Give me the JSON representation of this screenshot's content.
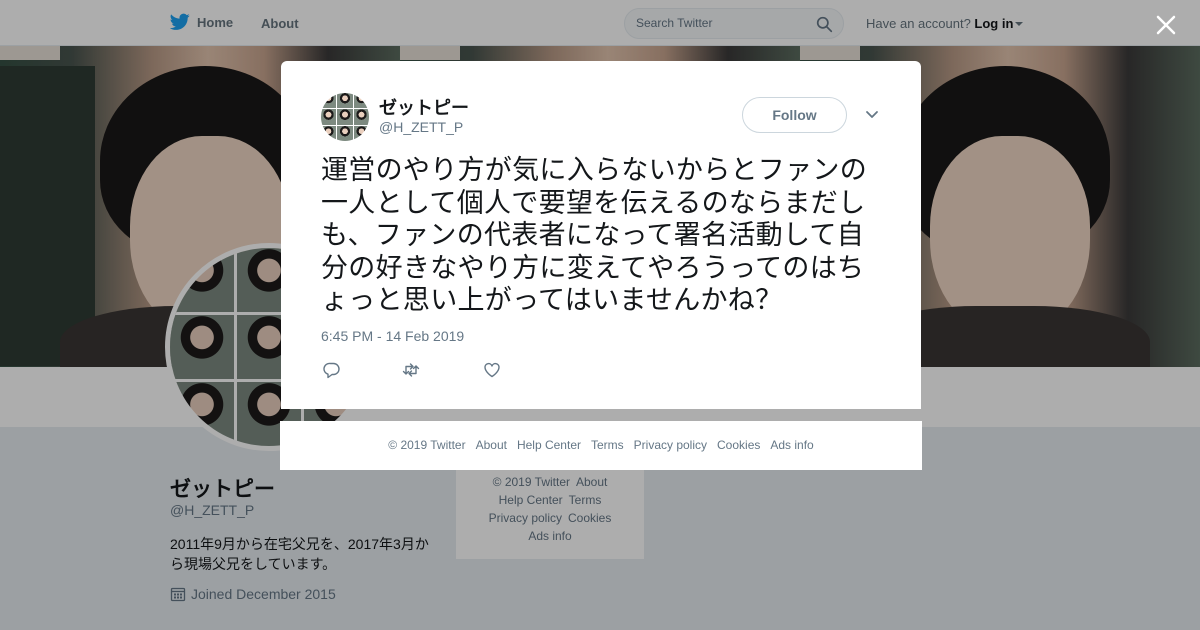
{
  "nav": {
    "home_label": "Home",
    "about_label": "About",
    "search_placeholder": "Search Twitter",
    "have_account": "Have an account?",
    "login_label": "Log in"
  },
  "profile": {
    "name": "ゼットピー",
    "handle": "@H_ZETT_P",
    "bio": "2011年9月から在宅父兄を、2017年3月から現場父兄をしています。",
    "joined": "Joined December 2015"
  },
  "side_footer": {
    "links": [
      "© 2019 Twitter",
      "About",
      "Help Center",
      "Terms",
      "Privacy policy",
      "Cookies",
      "Ads info"
    ]
  },
  "tweet": {
    "name": "ゼットピー",
    "handle": "@H_ZETT_P",
    "follow_label": "Follow",
    "text": "運営のやり方が気に入らないからとファンの一人として個人で要望を伝えるのならまだしも、ファンの代表者になって署名活動して自分の好きなやり方に変えてやろうってのはちょっと思い上がってはいませんかね？",
    "timestamp": "6:45 PM - 14 Feb 2019",
    "actions": [
      "reply-icon",
      "retweet-icon",
      "like-icon"
    ]
  },
  "card_footer": {
    "links": [
      "© 2019 Twitter",
      "About",
      "Help Center",
      "Terms",
      "Privacy policy",
      "Cookies",
      "Ads info"
    ]
  },
  "colors": {
    "brand": "#1da1f2",
    "text_secondary": "#657786",
    "background": "#e6ecf0"
  }
}
